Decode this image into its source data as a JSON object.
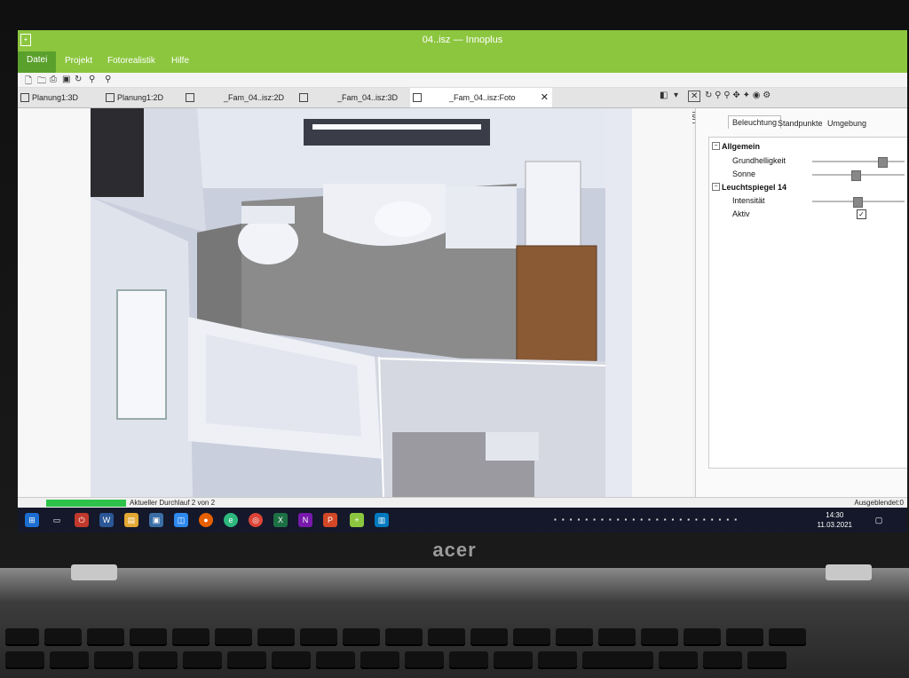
{
  "window": {
    "title": "04..isz — Innoplus"
  },
  "menu": [
    "Datei",
    "Projekt",
    "Fotorealistik",
    "Hilfe"
  ],
  "tabs": [
    {
      "label": "Planung1:3D"
    },
    {
      "label": "Planung1:2D"
    },
    {
      "label": "_Fam_04..isz:2D"
    },
    {
      "label": "_Fam_04..isz:3D"
    },
    {
      "label": "_Fam_04..isz:Foto",
      "active": true
    }
  ],
  "tooltip": "Schließen",
  "panel": {
    "tabs": [
      "Beleuchtung",
      "Standpunkte",
      "Umgebung"
    ],
    "tree": {
      "group1": "Allgemein",
      "grundhelligkeit": "Grundhelligkeit",
      "sonne": "Sonne",
      "group2": "Leuchtspiegel 14",
      "intensitaet": "Intensität",
      "aktiv": "Aktiv"
    },
    "sliders": {
      "grundhelligkeit": 0.78,
      "sonne": 0.46,
      "intensitaet": 0.48
    }
  },
  "status": {
    "progress_text": "Aktueller Durchlauf 2 von 2",
    "progress": 1.0,
    "hidden_count": "Ausgeblendet:0"
  },
  "taskbar": {
    "time": "14:30",
    "date": "11.03.2021"
  },
  "brand": "acer",
  "colors": {
    "accent": "#8cc63f",
    "menu_active": "#5aa02c",
    "taskbar": "#14182a"
  }
}
